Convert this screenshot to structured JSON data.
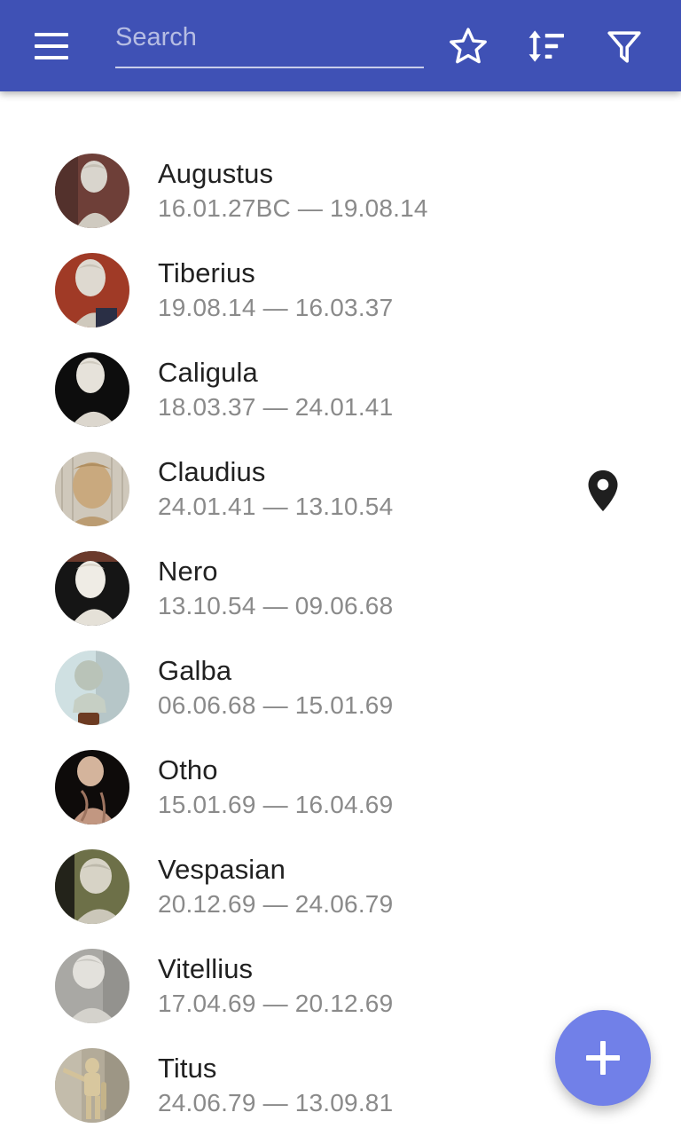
{
  "toolbar": {
    "menu_icon": "hamburger-menu-icon",
    "search": {
      "placeholder": "Search",
      "value": ""
    },
    "actions": [
      {
        "name": "favorites-button",
        "icon": "star-outline-icon",
        "label": "Favorites"
      },
      {
        "name": "sort-button",
        "icon": "sort-icon",
        "label": "Sort"
      },
      {
        "name": "filter-button",
        "icon": "filter-funnel-icon",
        "label": "Filter"
      }
    ],
    "background_color": "#3F51B5"
  },
  "list": {
    "items": [
      {
        "title": "Augustus",
        "dates": "16.01.27BC — 19.08.14",
        "avatar": "bust-augustus",
        "bg": "#6e3f38",
        "stone": "#d9d5cd"
      },
      {
        "title": "Tiberius",
        "dates": "19.08.14 — 16.03.37",
        "avatar": "bust-tiberius",
        "bg": "#a03a26",
        "stone": "#ded9d0"
      },
      {
        "title": "Caligula",
        "dates": "18.03.37 — 24.01.41",
        "avatar": "bust-caligula",
        "bg": "#0d0d0d",
        "stone": "#e6e2da"
      },
      {
        "title": "Claudius",
        "dates": "24.01.41 — 13.10.54",
        "avatar": "bust-claudius",
        "bg": "#cfc8bb",
        "stone": "#c9a97e"
      },
      {
        "title": "Nero",
        "dates": "13.10.54 — 09.06.68",
        "avatar": "bust-nero",
        "bg": "#151515",
        "stone": "#efece5"
      },
      {
        "title": "Galba",
        "dates": "06.06.68 — 15.01.69",
        "avatar": "bust-galba",
        "bg": "#cfe0e2",
        "stone": "#b9c3b8"
      },
      {
        "title": "Otho",
        "dates": "15.01.69 — 16.04.69",
        "avatar": "bust-otho",
        "bg": "#0e0b0a",
        "stone": "#c29781"
      },
      {
        "title": "Vespasian",
        "dates": "20.12.69 — 24.06.79",
        "avatar": "bust-vespasian",
        "bg": "#6d7048",
        "stone": "#d7d3c6"
      },
      {
        "title": "Vitellius",
        "dates": "17.04.69 — 20.12.69",
        "avatar": "bust-vitellius",
        "bg": "#a9a8a4",
        "stone": "#e3e1dc"
      },
      {
        "title": "Titus",
        "dates": "24.06.79 — 13.09.81",
        "avatar": "bust-titus",
        "bg": "#b3ab99",
        "stone": "#d8c79e"
      }
    ]
  },
  "map_pin": {
    "name": "location-pin-icon",
    "color": "#1f1f1f"
  },
  "fab": {
    "label": "+",
    "name": "add-button",
    "color": "#7180E8"
  }
}
